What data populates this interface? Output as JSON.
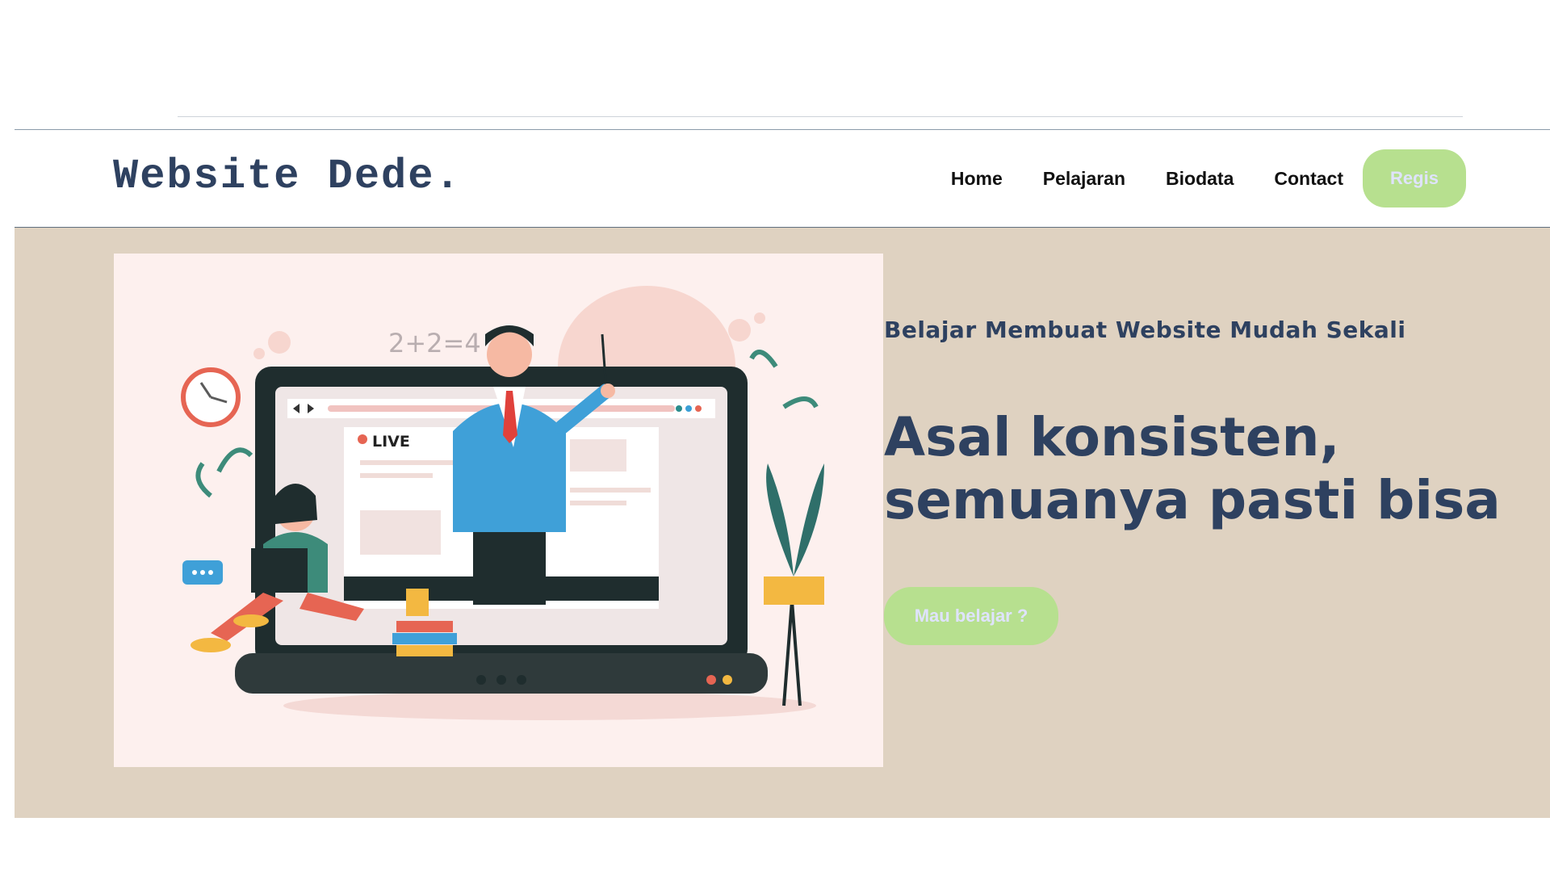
{
  "header": {
    "brand": "Website Dede.",
    "nav": [
      "Home",
      "Pelajaran",
      "Biodata",
      "Contact"
    ],
    "regis_label": "Regis"
  },
  "hero": {
    "tagline": "Belajar Membuat Website Mudah Sekali",
    "headline_line1": "Asal konsisten,",
    "headline_line2": "semuanya pasti bisa",
    "cta_label": "Mau belajar ?",
    "illustration": {
      "live_label": "LIVE",
      "math_text": "2+2=4"
    }
  },
  "colors": {
    "brand": "#2e4160",
    "hero_bg": "#dfd2c1",
    "button": "#b7e08f",
    "button_text": "#dfe3ff",
    "illustration_bg": "#fdf0ee"
  }
}
